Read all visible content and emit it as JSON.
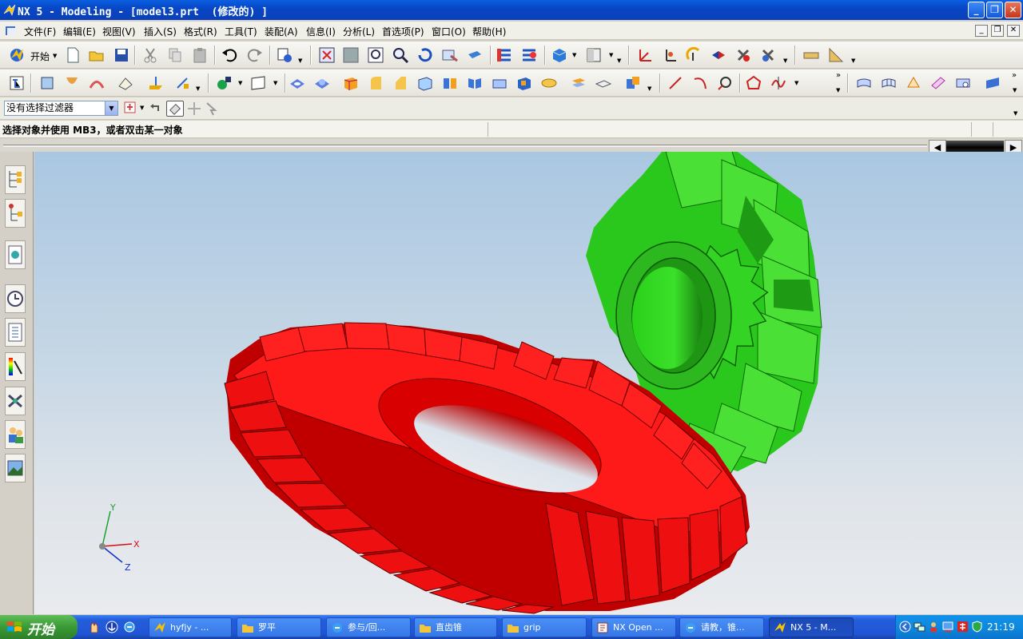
{
  "window": {
    "title": "NX 5 - Modeling - [model3.prt  (修改的) ]",
    "min": "_",
    "max": "❐",
    "close": "✕"
  },
  "menu": {
    "items": [
      "文件(F)",
      "编辑(E)",
      "视图(V)",
      "插入(S)",
      "格式(R)",
      "工具(T)",
      "装配(A)",
      "信息(I)",
      "分析(L)",
      "首选项(P)",
      "窗口(O)",
      "帮助(H)"
    ]
  },
  "toolbar": {
    "start_label": "开始"
  },
  "filter": {
    "value": "没有选择过滤器"
  },
  "cue": {
    "text": "选择对象并使用 MB3，或者双击某一对象"
  },
  "triad": {
    "x": "X",
    "y": "Y",
    "z": "Z"
  },
  "colors": {
    "ring_gear": "#ff0000",
    "pinion_gear": "#33dd22",
    "titlebar": "#0a50d0",
    "taskbar": "#245edb"
  },
  "taskbar": {
    "start": "开始",
    "tasks": [
      {
        "label": "hyfjy - ..."
      },
      {
        "label": "罗平"
      },
      {
        "label": "参与/回..."
      },
      {
        "label": "直齿锥"
      },
      {
        "label": "grip"
      },
      {
        "label": "NX Open ..."
      },
      {
        "label": "请教，锥..."
      },
      {
        "label": "NX 5 - M..."
      }
    ],
    "clock": "21:19"
  }
}
